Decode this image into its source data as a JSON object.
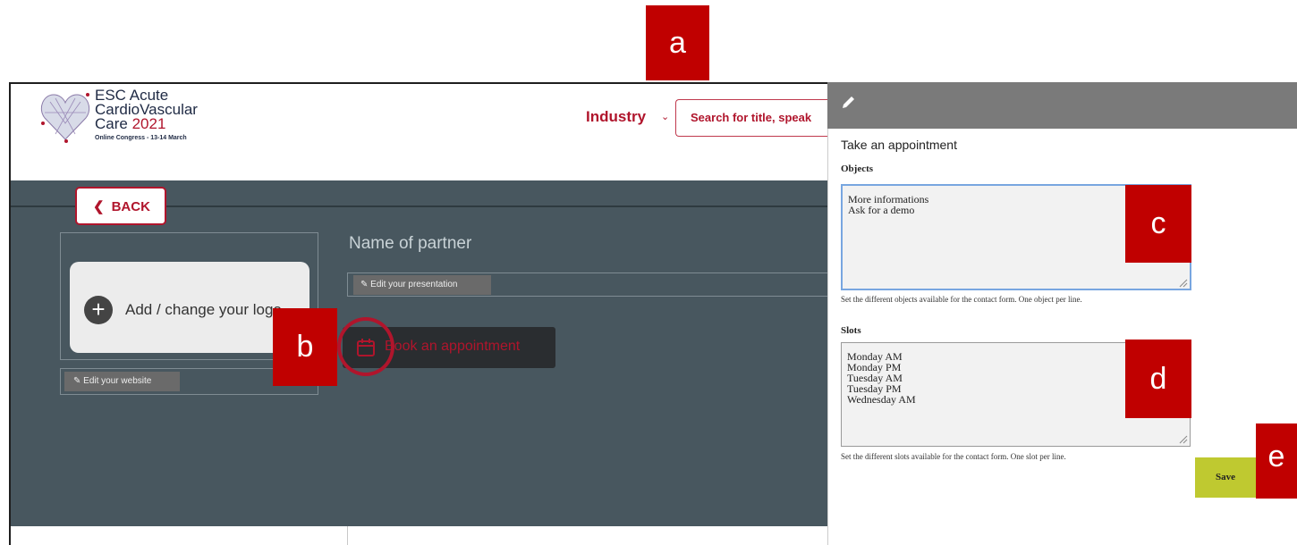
{
  "header": {
    "logo_line1": "ESC Acute",
    "logo_line2": "CardioVascular",
    "logo_line3_prefix": "Care ",
    "logo_year": "2021",
    "logo_sub": "Online Congress - 13-14 March",
    "nav_label": "Industry",
    "search_placeholder": "Search for title, speak"
  },
  "back_button": {
    "label": "BACK"
  },
  "logo_card": {
    "label": "Add / change your logo"
  },
  "edit_website": {
    "label": "Edit your website"
  },
  "partner": {
    "name": "Name of partner",
    "edit_presentation": "Edit your presentation",
    "book_label": "Book an appointment"
  },
  "panel": {
    "title": "Take an appointment",
    "objects_label": "Objects",
    "objects_value": "More informations\nAsk for a demo",
    "objects_help": "Set the different objects available for the contact form. One object per line.",
    "slots_label": "Slots",
    "slots_value": "Monday AM\nMonday PM\nTuesday AM\nTuesday PM\nWednesday AM",
    "slots_help": "Set the different slots available for the contact form. One slot per line.",
    "save_label": "Save"
  },
  "annotations": {
    "a": "a",
    "b": "b",
    "c": "c",
    "d": "d",
    "e": "e"
  },
  "colors": {
    "brand_red": "#b0152c",
    "annotation_red": "#c00000",
    "page_bg": "#48575f",
    "save_bg": "#bfc930",
    "panel_bar": "#7a7a7a"
  },
  "icons": {
    "logo": "esc-heart-logo",
    "back": "chevron-left-icon",
    "add": "plus-circle-icon",
    "edit": "pencil-icon",
    "calendar": "calendar-icon",
    "dropdown": "chevron-down-icon"
  }
}
